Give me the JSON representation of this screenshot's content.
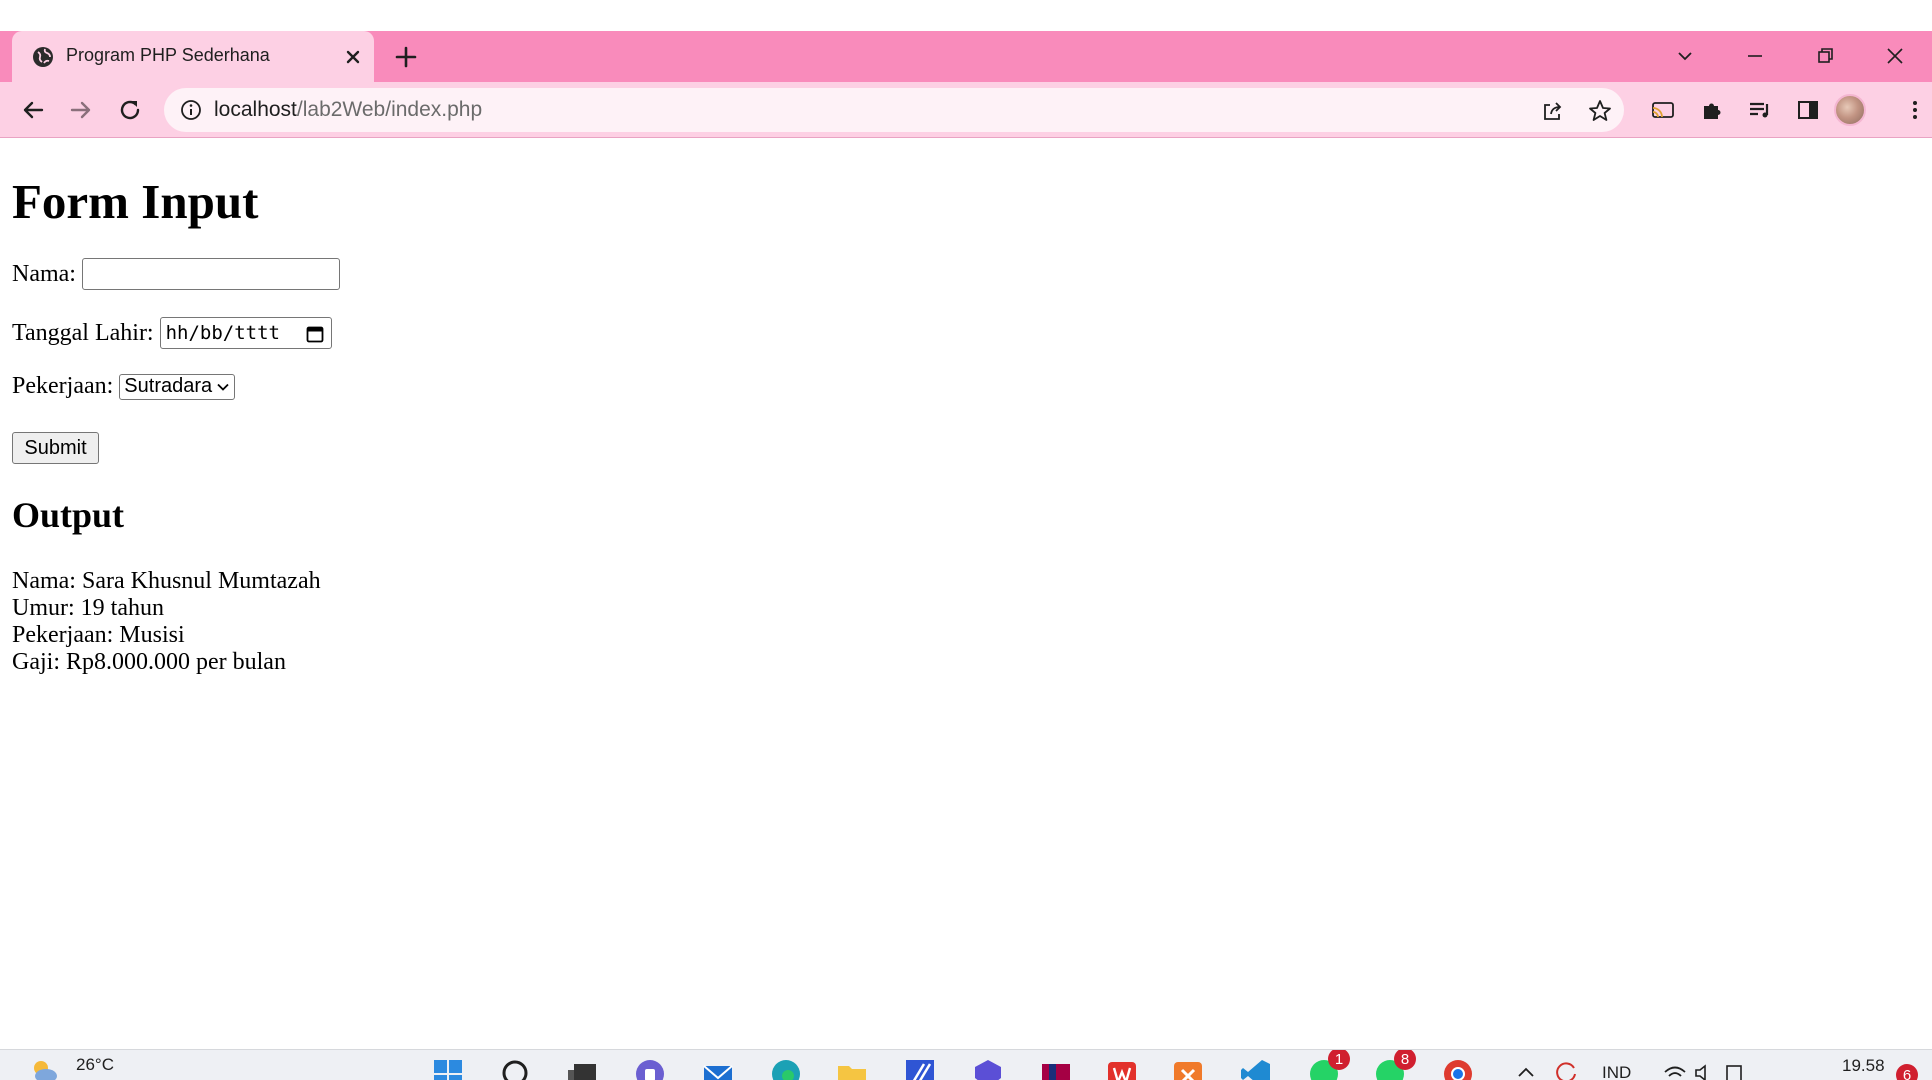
{
  "browser": {
    "tab_title": "Program PHP Sederhana",
    "url_host": "localhost",
    "url_path": "/lab2Web/index.php"
  },
  "page": {
    "heading": "Form Input",
    "fields": {
      "nama_label": "Nama:",
      "nama_value": "",
      "tanggal_label": "Tanggal Lahir:",
      "tanggal_placeholder": "hh/bb/tttt",
      "pekerjaan_label": "Pekerjaan:",
      "pekerjaan_selected": "Sutradara"
    },
    "submit_label": "Submit",
    "output_heading": "Output",
    "output_lines": [
      "Nama: Sara Khusnul Mumtazah",
      "Umur: 19 tahun",
      "Pekerjaan: Musisi",
      "Gaji: Rp8.000.000 per bulan"
    ]
  },
  "taskbar": {
    "weather_temp": "26°C",
    "whatsapp_badge": "1",
    "whatsapp_business_badge": "8",
    "language": "IND",
    "clock": "19.58",
    "notification_count": "6"
  },
  "colors": {
    "tabbar": "#f98bbb",
    "toolbar": "#fdd0e4",
    "active_tab": "#fdd0e4"
  }
}
